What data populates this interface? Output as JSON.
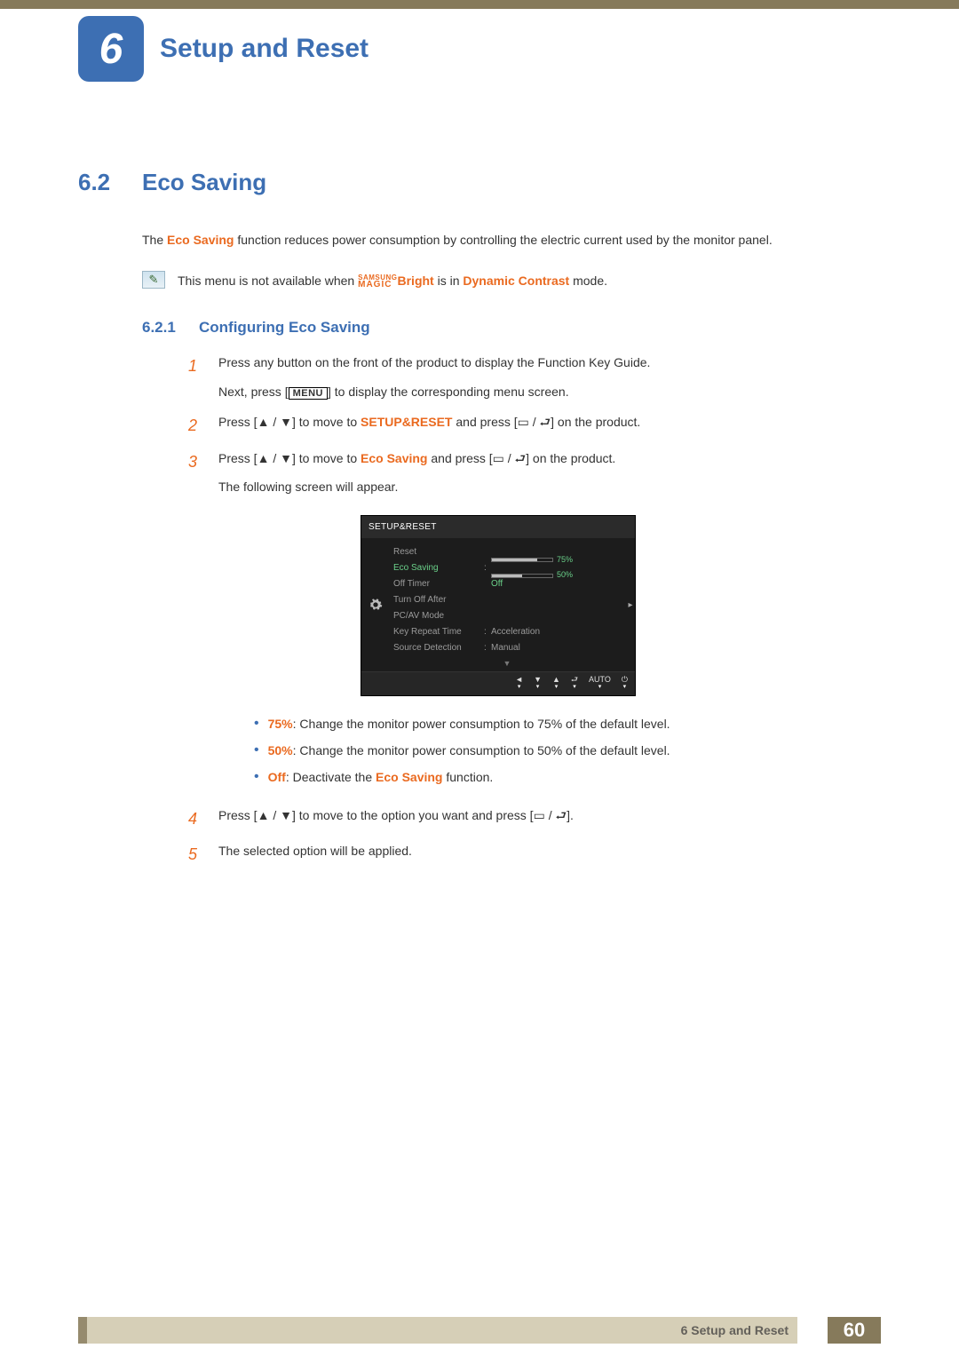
{
  "chapter": {
    "num": "6",
    "title": "Setup and Reset"
  },
  "section": {
    "num": "6.2",
    "title": "Eco Saving"
  },
  "intro": {
    "pre": "The ",
    "hl": "Eco Saving",
    "post": " function reduces power consumption by controlling the electric current used by the monitor panel."
  },
  "note": {
    "pre": "This menu is not available when ",
    "brand_top": "SAMSUNG",
    "brand_bot": "MAGIC",
    "bright": "Bright",
    "mid": " is in ",
    "dc": "Dynamic Contrast",
    "post": " mode."
  },
  "subsection": {
    "num": "6.2.1",
    "title": "Configuring Eco Saving"
  },
  "step1": {
    "a": "Press any button on the front of the product to display the Function Key Guide.",
    "b_pre": "Next, press [",
    "b_key": "MENU",
    "b_post": "] to display the corresponding menu screen."
  },
  "step2": {
    "pre": "Press [",
    "mid1": "] to move to ",
    "target": "SETUP&RESET",
    "mid2": " and press [",
    "post": "] on the product."
  },
  "step3": {
    "pre": "Press [",
    "mid1": "] to move to ",
    "target": "Eco Saving",
    "mid2": " and press [",
    "post": "] on the product.",
    "tail": "The following screen will appear."
  },
  "osd": {
    "title": "SETUP&RESET",
    "rows": {
      "reset": "Reset",
      "eco": "Eco Saving",
      "offtimer": "Off Timer",
      "turnoff": "Turn Off After",
      "pcav": "PC/AV Mode",
      "keyrep": "Key Repeat Time",
      "srcdet": "Source Detection"
    },
    "vals": {
      "eco75": "75%",
      "eco50": "50%",
      "off": "Off",
      "acc": "Acceleration",
      "man": "Manual",
      "auto": "AUTO"
    }
  },
  "bullets": {
    "b1_hl": "75%",
    "b1": ": Change the monitor power consumption to 75% of the default level.",
    "b2_hl": "50%",
    "b2": ": Change the monitor power consumption to 50% of the default level.",
    "b3_hl": "Off",
    "b3_a": ": Deactivate the ",
    "b3_eco": "Eco Saving",
    "b3_b": " function."
  },
  "step4": {
    "pre": "Press [",
    "mid": "] to move to the option you want and press [",
    "post": "]."
  },
  "step5": "The selected option will be applied.",
  "footer": {
    "text": "6 Setup and Reset",
    "page": "60"
  },
  "glyphs": {
    "updown": "▲ / ▼",
    "enter": "▭ / ⮐"
  }
}
